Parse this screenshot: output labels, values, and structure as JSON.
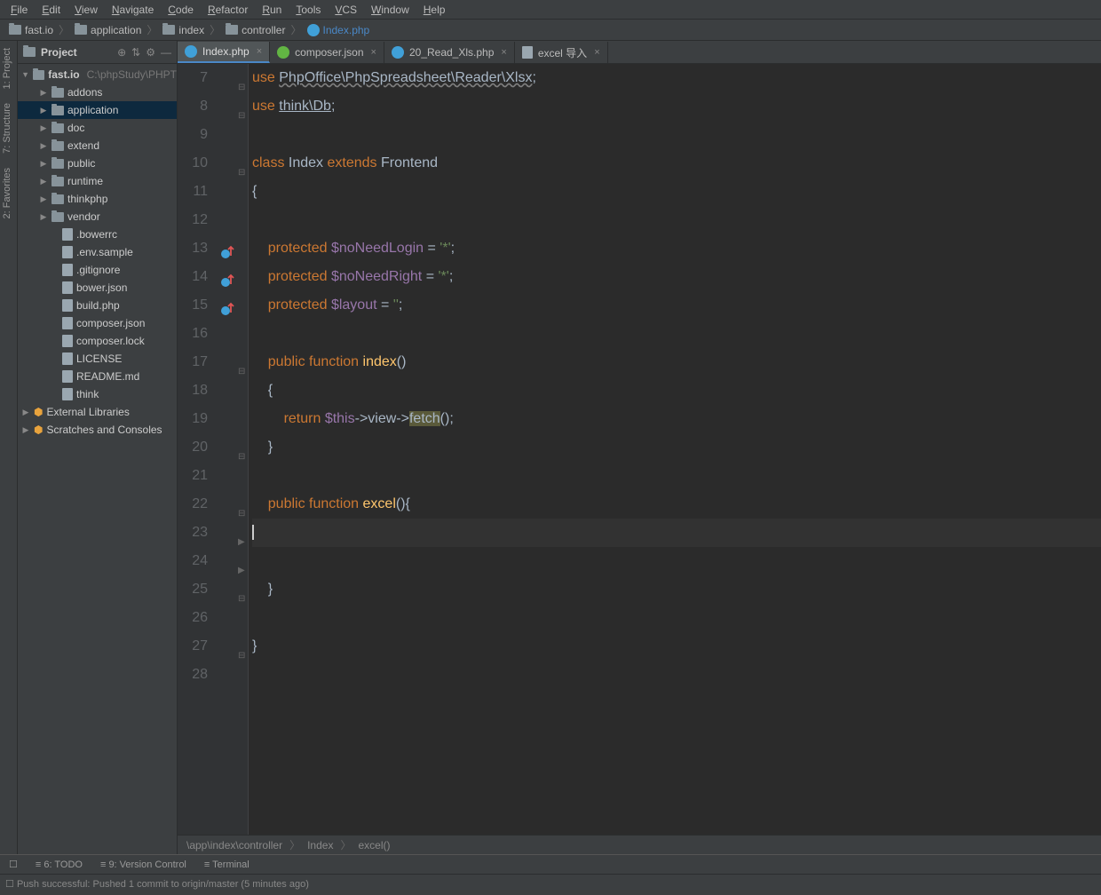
{
  "menu": [
    "File",
    "Edit",
    "View",
    "Navigate",
    "Code",
    "Refactor",
    "Run",
    "Tools",
    "VCS",
    "Window",
    "Help"
  ],
  "breadcrumbs": [
    {
      "label": "fast.io",
      "type": "folder"
    },
    {
      "label": "application",
      "type": "folder"
    },
    {
      "label": "index",
      "type": "folder"
    },
    {
      "label": "controller",
      "type": "folder"
    },
    {
      "label": "Index.php",
      "type": "php",
      "active": true
    }
  ],
  "leftrail": [
    "1: Project",
    "7: Structure",
    "2: Favorites"
  ],
  "sidebar": {
    "title": "Project",
    "root": {
      "label": "fast.io",
      "suffix": "C:\\phpStudy\\PHPT"
    },
    "tree": [
      {
        "label": "addons",
        "icon": "folder",
        "indent": 2,
        "arr": "▶"
      },
      {
        "label": "application",
        "icon": "folder",
        "indent": 2,
        "arr": "▶",
        "sel": true
      },
      {
        "label": "doc",
        "icon": "folder",
        "indent": 2,
        "arr": "▶"
      },
      {
        "label": "extend",
        "icon": "folder",
        "indent": 2,
        "arr": "▶"
      },
      {
        "label": "public",
        "icon": "folder",
        "indent": 2,
        "arr": "▶"
      },
      {
        "label": "runtime",
        "icon": "folder",
        "indent": 2,
        "arr": "▶"
      },
      {
        "label": "thinkphp",
        "icon": "folder",
        "indent": 2,
        "arr": "▶"
      },
      {
        "label": "vendor",
        "icon": "folder",
        "indent": 2,
        "arr": "▶"
      },
      {
        "label": ".bowerrc",
        "icon": "file",
        "indent": 3
      },
      {
        "label": ".env.sample",
        "icon": "file",
        "indent": 3
      },
      {
        "label": ".gitignore",
        "icon": "file",
        "indent": 3
      },
      {
        "label": "bower.json",
        "icon": "file",
        "indent": 3
      },
      {
        "label": "build.php",
        "icon": "file",
        "indent": 3
      },
      {
        "label": "composer.json",
        "icon": "file",
        "indent": 3
      },
      {
        "label": "composer.lock",
        "icon": "file",
        "indent": 3
      },
      {
        "label": "LICENSE",
        "icon": "file",
        "indent": 3
      },
      {
        "label": "README.md",
        "icon": "file",
        "indent": 3
      },
      {
        "label": "think",
        "icon": "file",
        "indent": 3
      }
    ],
    "libs": "External Libraries",
    "scratches": "Scratches and Consoles"
  },
  "tabs": [
    {
      "label": "Index.php",
      "active": true,
      "kind": "php"
    },
    {
      "label": "composer.json",
      "kind": "json"
    },
    {
      "label": "20_Read_Xls.php",
      "kind": "php"
    },
    {
      "label": "excel 导入",
      "kind": "txt"
    }
  ],
  "gutter_start": 7,
  "gutter_end": 28,
  "code_lines": [
    {
      "html": "<span class='kw'>use</span> <span style='text-decoration:underline wavy #808080'>PhpOffice\\PhpSpreadsheet\\Reader\\Xlsx</span>;"
    },
    {
      "html": "<span class='kw'>use</span> <span style='text-decoration:underline'>think\\Db</span>;"
    },
    {
      "html": ""
    },
    {
      "html": "<span class='kw'>class</span> Index <span class='kw'>extends</span> Frontend"
    },
    {
      "html": "{"
    },
    {
      "html": ""
    },
    {
      "html": "    <span class='kw'>protected</span> <span class='var'>$noNeedLogin</span> = <span class='str'>'*'</span>;"
    },
    {
      "html": "    <span class='kw'>protected</span> <span class='var'>$noNeedRight</span> = <span class='str'>'*'</span>;"
    },
    {
      "html": "    <span class='kw'>protected</span> <span class='var'>$layout</span> = <span class='str'>''</span>;"
    },
    {
      "html": ""
    },
    {
      "html": "    <span class='kw'>public function</span> <span class='fn'>index</span>()"
    },
    {
      "html": "    {"
    },
    {
      "html": "        <span class='kw'>return</span> <span class='var'>$this</span>-&gt;view-&gt;<span class='hl'>fetch</span>();"
    },
    {
      "html": "    }"
    },
    {
      "html": ""
    },
    {
      "html": "    <span class='kw'>public function</span> <span class='fn'>excel</span>(){"
    },
    {
      "html": "<span class='cursor'></span>",
      "cur": true
    },
    {
      "html": ""
    },
    {
      "html": "    }"
    },
    {
      "html": ""
    },
    {
      "html": "}"
    },
    {
      "html": ""
    }
  ],
  "code_crumb": [
    "\\app\\index\\controller",
    "Index",
    "excel()"
  ],
  "bottom_tools": [
    "6: TODO",
    "9: Version Control",
    "Terminal"
  ],
  "status": "Push successful: Pushed 1 commit to origin/master (5 minutes ago)"
}
